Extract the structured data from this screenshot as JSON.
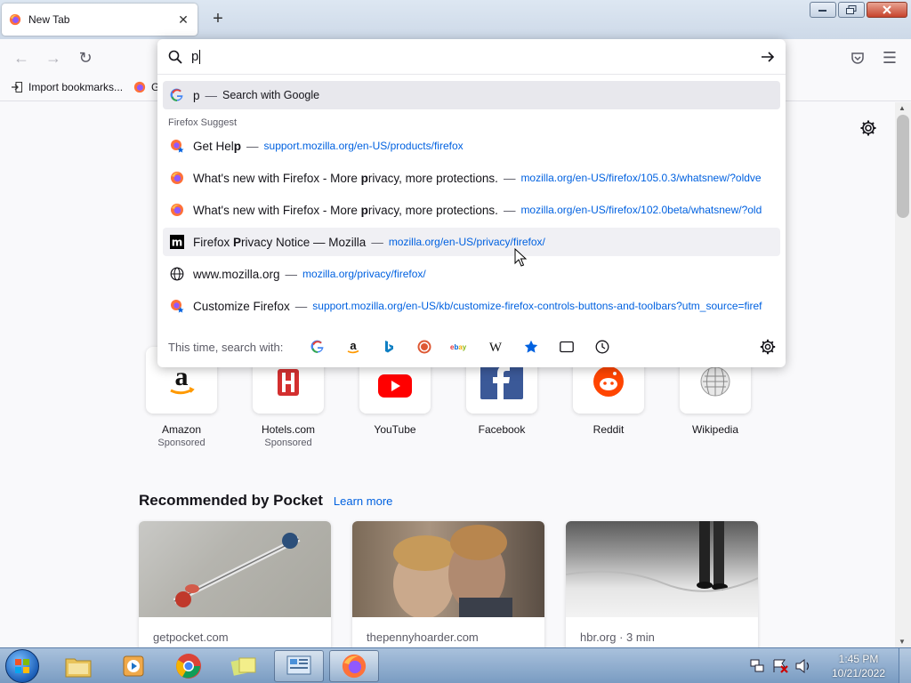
{
  "tab": {
    "title": "New Tab",
    "close": "✕"
  },
  "newtab": "+",
  "toolbar": {
    "back": "←",
    "forward": "→",
    "reload": "↻",
    "menu": "☰"
  },
  "bookmarks": {
    "import_label": "Import bookmarks...",
    "next_label": "G"
  },
  "urlbar": {
    "value": "p",
    "go": "→",
    "google_row": {
      "term": "p",
      "dash": "—",
      "action": "Search with Google"
    },
    "suggest_label": "Firefox Suggest",
    "suggestions": [
      {
        "title_pre": "Get Hel",
        "title_bold": "p",
        "title_post": "",
        "dash": "—",
        "url": "support.mozilla.org/en-US/products/firefox",
        "icon": "firefox-star-icon"
      },
      {
        "title_pre": "What's new with Firefox - More ",
        "title_bold": "p",
        "title_post": "rivacy, more protections.",
        "dash": "—",
        "url": "mozilla.org/en-US/firefox/105.0.3/whatsnew/?oldve",
        "icon": "firefox-icon"
      },
      {
        "title_pre": "What's new with Firefox - More ",
        "title_bold": "p",
        "title_post": "rivacy, more protections.",
        "dash": "—",
        "url": "mozilla.org/en-US/firefox/102.0beta/whatsnew/?old",
        "icon": "firefox-icon"
      },
      {
        "title_pre": "Firefox ",
        "title_bold": "P",
        "title_post": "rivacy Notice — Mozilla",
        "dash": "—",
        "url": "mozilla.org/en-US/privacy/firefox/",
        "icon": "mozilla-m-icon"
      },
      {
        "title_pre": "www.mozilla.org",
        "title_bold": "",
        "title_post": "",
        "dash": "—",
        "url": "mozilla.org/privacy/firefox/",
        "icon": "globe-icon"
      },
      {
        "title_pre": "Customize Firefox",
        "title_bold": "",
        "title_post": "",
        "dash": "—",
        "url": "support.mozilla.org/en-US/kb/customize-firefox-controls-buttons-and-toolbars?utm_source=firef",
        "icon": "firefox-star-icon"
      }
    ],
    "onetime_label": "This time, search with:"
  },
  "tiles": [
    {
      "name": "Amazon",
      "sponsored": "Sponsored"
    },
    {
      "name": "Hotels.com",
      "sponsored": "Sponsored"
    },
    {
      "name": "YouTube",
      "sponsored": ""
    },
    {
      "name": "Facebook",
      "sponsored": ""
    },
    {
      "name": "Reddit",
      "sponsored": ""
    },
    {
      "name": "Wikipedia",
      "sponsored": ""
    }
  ],
  "pocket": {
    "heading": "Recommended by Pocket",
    "learn_more": "Learn more",
    "cards": [
      {
        "source": "getpocket.com"
      },
      {
        "source": "thepennyhoarder.com"
      },
      {
        "source": "hbr.org · 3 min"
      }
    ]
  },
  "taskbar": {
    "time": "1:45 PM",
    "date": "10/21/2022"
  },
  "colors": {
    "link": "#0061e0",
    "accent_firefox": "#ff7139"
  }
}
